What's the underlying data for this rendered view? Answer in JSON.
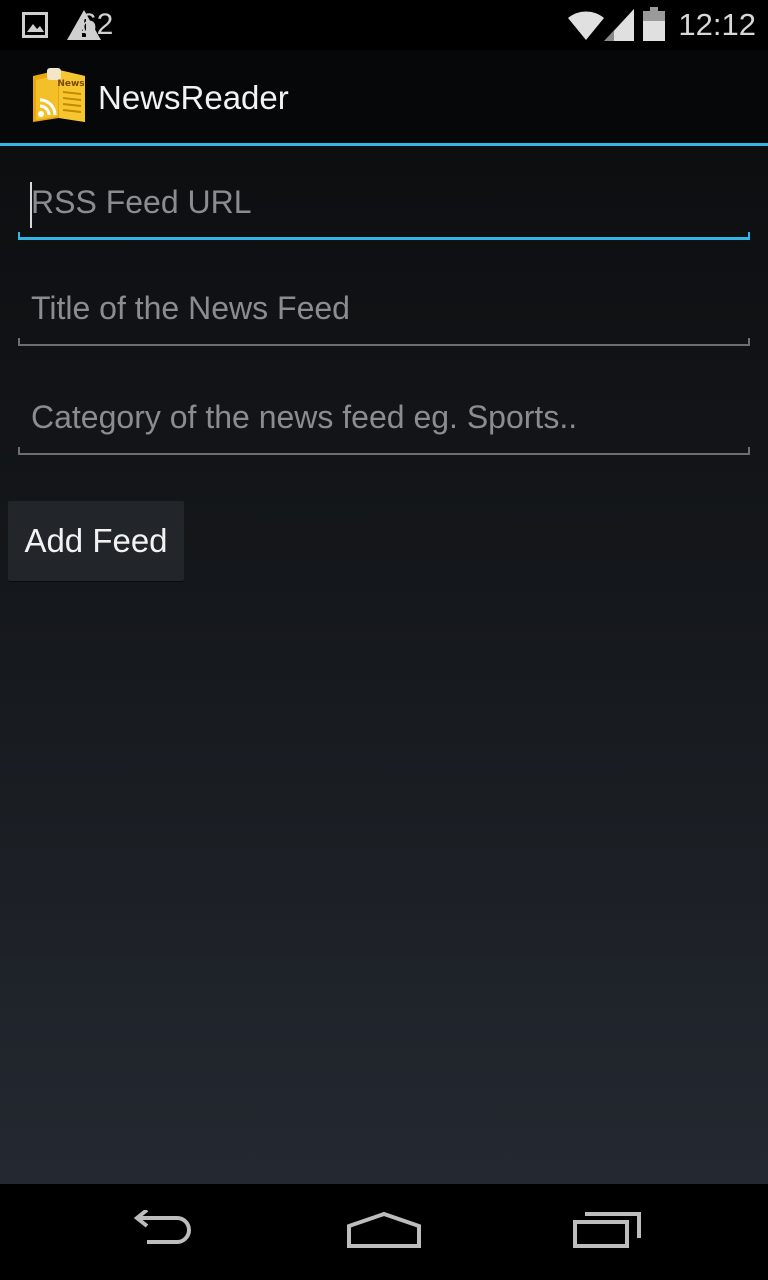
{
  "status_bar": {
    "notification_icons": [
      "image-icon",
      "warning-icon"
    ],
    "battery_level": "62",
    "system_icons": [
      "wifi-icon",
      "signal-icon",
      "battery-icon"
    ],
    "time": "12:12"
  },
  "action_bar": {
    "app_icon": "news-app-icon",
    "title": "NewsReader",
    "divider_color": "#33b5e5"
  },
  "form": {
    "feed_url": {
      "value": "",
      "placeholder": "RSS Feed URL"
    },
    "feed_title": {
      "value": "",
      "placeholder": "Title of the News Feed"
    },
    "feed_category": {
      "value": "",
      "placeholder": "Category of the news feed eg. Sports.."
    },
    "add_button_label": "Add Feed"
  },
  "nav_bar": {
    "buttons": [
      "back-icon",
      "home-icon",
      "recent-apps-icon"
    ]
  },
  "colors": {
    "accent": "#33b5e5",
    "background_top": "#0d0e10",
    "background_bottom": "#242931"
  }
}
